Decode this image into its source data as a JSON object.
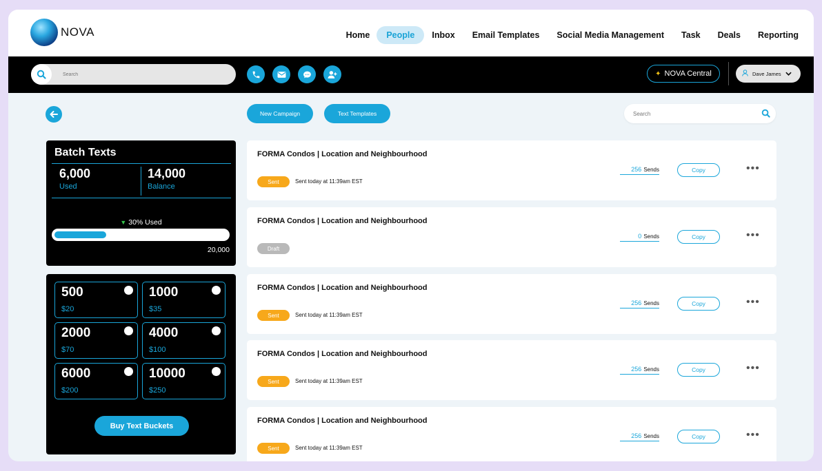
{
  "app": {
    "logo_text": "NOVA"
  },
  "nav": {
    "links": [
      {
        "label": "Home",
        "active": false
      },
      {
        "label": "People",
        "active": true
      },
      {
        "label": "Inbox",
        "active": false
      },
      {
        "label": "Email Templates",
        "active": false
      },
      {
        "label": "Social Media Management",
        "active": false
      },
      {
        "label": "Task",
        "active": false
      },
      {
        "label": "Deals",
        "active": false
      },
      {
        "label": "Reporting",
        "active": false
      }
    ]
  },
  "toolbar": {
    "search_placeholder": "Search",
    "quick_actions": [
      "phone-icon",
      "mail-icon",
      "chat-icon",
      "add-user-icon"
    ],
    "nova_central_label": "NOVA Central",
    "user_name": "Dave James"
  },
  "actions": {
    "new_campaign_label": "New Campaign",
    "text_templates_label": "Text Templates",
    "search_placeholder": "Search"
  },
  "batch": {
    "title": "Batch Texts",
    "used_value": "6,000",
    "used_label": "Used",
    "balance_value": "14,000",
    "balance_label": "Balance",
    "used_percent_label": "30% Used",
    "used_fraction": 0.3,
    "total": "20,000"
  },
  "buckets": {
    "items": [
      {
        "amount": "500",
        "price": "$20"
      },
      {
        "amount": "1000",
        "price": "$35"
      },
      {
        "amount": "2000",
        "price": "$70"
      },
      {
        "amount": "4000",
        "price": "$100"
      },
      {
        "amount": "6000",
        "price": "$200"
      },
      {
        "amount": "10000",
        "price": "$250"
      }
    ],
    "buy_label": "Buy Text Buckets"
  },
  "campaigns": [
    {
      "title": "FORMA Condos | Location and Neighbourhood",
      "status": "Sent",
      "time": "Sent today at 11:39am EST",
      "sends_count": "256",
      "sends_label": "Sends",
      "copy_label": "Copy"
    },
    {
      "title": "FORMA Condos | Location and Neighbourhood",
      "status": "Draft",
      "time": "",
      "sends_count": "0",
      "sends_label": "Sends",
      "copy_label": "Copy"
    },
    {
      "title": "FORMA Condos | Location and Neighbourhood",
      "status": "Sent",
      "time": "Sent today at 11:39am EST",
      "sends_count": "256",
      "sends_label": "Sends",
      "copy_label": "Copy"
    },
    {
      "title": "FORMA Condos | Location and Neighbourhood",
      "status": "Sent",
      "time": "Sent today at 11:39am EST",
      "sends_count": "256",
      "sends_label": "Sends",
      "copy_label": "Copy"
    },
    {
      "title": "FORMA Condos | Location and Neighbourhood",
      "status": "Sent",
      "time": "Sent today at 11:39am EST",
      "sends_count": "256",
      "sends_label": "Sends",
      "copy_label": "Copy"
    }
  ],
  "colors": {
    "accent": "#1aa6da",
    "sent": "#f7a81b",
    "draft": "#b9b9b9",
    "page_bg": "#eef4f8",
    "outer_bg": "#e6ddf7"
  }
}
